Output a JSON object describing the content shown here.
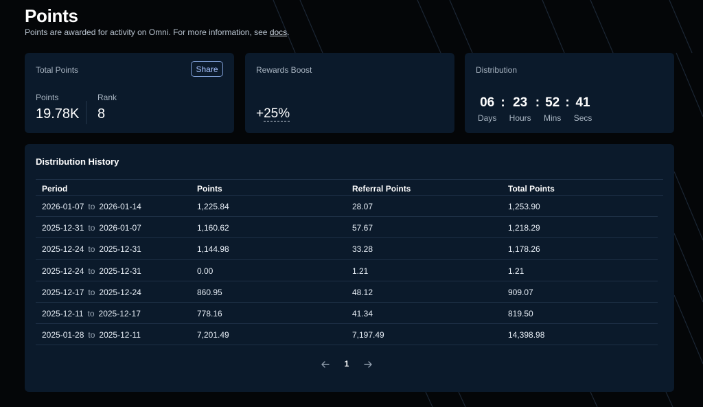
{
  "header": {
    "title": "Points",
    "subtitle_prefix": "Points are awarded for activity on Omni. For more information, see ",
    "subtitle_link": "docs",
    "subtitle_suffix": "."
  },
  "total_points": {
    "label": "Total Points",
    "share_label": "Share",
    "points_label": "Points",
    "points_value": "19.78K",
    "rank_label": "Rank",
    "rank_value": "8"
  },
  "rewards_boost": {
    "label": "Rewards Boost",
    "sign": "+",
    "value": "25%"
  },
  "distribution": {
    "label": "Distribution",
    "days": "06",
    "hours": "23",
    "mins": "52",
    "secs": "41",
    "separator": ":",
    "days_label": "Days",
    "hours_label": "Hours",
    "mins_label": "Mins",
    "secs_label": "Secs"
  },
  "history": {
    "title": "Distribution History",
    "columns": [
      "Period",
      "Points",
      "Referral Points",
      "Total Points"
    ],
    "period_sep": "to",
    "rows": [
      {
        "start": "2026-01-07",
        "end": "2026-01-14",
        "points": "1,225.84",
        "referral": "28.07",
        "total": "1,253.90"
      },
      {
        "start": "2025-12-31",
        "end": "2026-01-07",
        "points": "1,160.62",
        "referral": "57.67",
        "total": "1,218.29"
      },
      {
        "start": "2025-12-24",
        "end": "2025-12-31",
        "points": "1,144.98",
        "referral": "33.28",
        "total": "1,178.26"
      },
      {
        "start": "2025-12-24",
        "end": "2025-12-31",
        "points": "0.00",
        "referral": "1.21",
        "total": "1.21"
      },
      {
        "start": "2025-12-17",
        "end": "2025-12-24",
        "points": "860.95",
        "referral": "48.12",
        "total": "909.07"
      },
      {
        "start": "2025-12-11",
        "end": "2025-12-17",
        "points": "778.16",
        "referral": "41.34",
        "total": "819.50"
      },
      {
        "start": "2025-01-28",
        "end": "2025-12-11",
        "points": "7,201.49",
        "referral": "7,197.49",
        "total": "14,398.98"
      }
    ],
    "pagination": {
      "current_page": "1"
    }
  },
  "icons": {
    "prev": "arrow-left-icon",
    "next": "arrow-right-icon"
  },
  "colors": {
    "background": "#040608",
    "card": "#0b1a2b",
    "accent": "#a9c4ff"
  }
}
